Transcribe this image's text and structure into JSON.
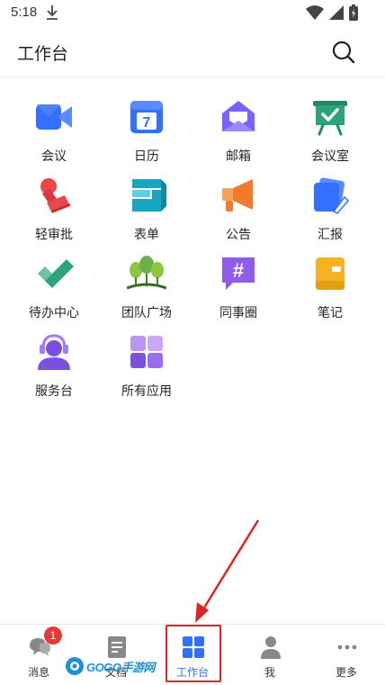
{
  "status_bar": {
    "time": "5:18",
    "icons": [
      "download-icon",
      "wifi-icon",
      "signal-icon",
      "battery-icon"
    ]
  },
  "header": {
    "title": "工作台",
    "search_icon": "search-icon"
  },
  "apps": [
    {
      "label": "会议",
      "icon": "video-meeting-icon",
      "color": "#3370ff"
    },
    {
      "label": "日历",
      "icon": "calendar-icon",
      "color": "#3370ff",
      "glyph": "7"
    },
    {
      "label": "邮箱",
      "icon": "mail-icon",
      "color": "#7b61ff"
    },
    {
      "label": "会议室",
      "icon": "meeting-room-icon",
      "color": "#2ea37a"
    },
    {
      "label": "轻审批",
      "icon": "stamp-icon",
      "color": "#e8474d"
    },
    {
      "label": "表单",
      "icon": "form-icon",
      "color": "#14a6c3"
    },
    {
      "label": "公告",
      "icon": "megaphone-icon",
      "color": "#f27a2a"
    },
    {
      "label": "汇报",
      "icon": "report-icon",
      "color": "#3370ff"
    },
    {
      "label": "待办中心",
      "icon": "checkmark-icon",
      "color": "#2ea37a"
    },
    {
      "label": "团队广场",
      "icon": "team-plaza-icon",
      "color": "#6ab04c"
    },
    {
      "label": "同事圈",
      "icon": "hashtag-icon",
      "color": "#8e5ce8",
      "glyph": "#"
    },
    {
      "label": "笔记",
      "icon": "notebook-icon",
      "color": "#f5b324"
    },
    {
      "label": "服务台",
      "icon": "support-agent-icon",
      "color": "#7b4fe0"
    },
    {
      "label": "所有应用",
      "icon": "all-apps-icon",
      "color": "#9b6cf0"
    }
  ],
  "bottom_nav": {
    "tabs": [
      {
        "label": "消息",
        "icon": "chat-icon",
        "badge": "1"
      },
      {
        "label": "文档",
        "icon": "document-icon"
      },
      {
        "label": "工作台",
        "icon": "grid-icon",
        "active": true
      },
      {
        "label": "我",
        "icon": "person-icon"
      },
      {
        "label": "更多",
        "icon": "more-icon"
      }
    ]
  },
  "annotation": {
    "color": "#e02424"
  },
  "watermark": {
    "text": "GOGO手游网"
  },
  "colors": {
    "accent": "#3370ff",
    "text": "#1f2329",
    "badge": "#e53935"
  }
}
